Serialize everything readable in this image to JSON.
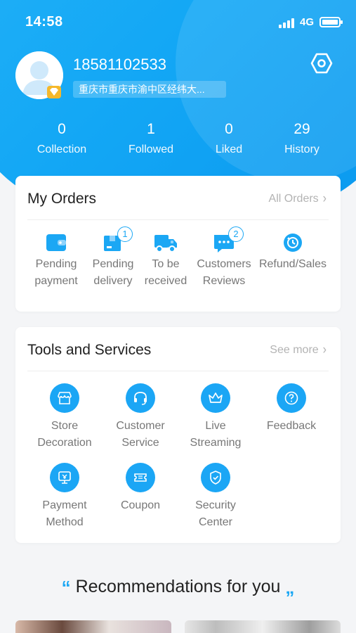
{
  "status_bar": {
    "time": "14:58",
    "network": "4G",
    "battery_level": 1.0
  },
  "profile": {
    "phone": "18581102533",
    "address": "重庆市重庆市渝中区经纬大..."
  },
  "stats": [
    {
      "value": "0",
      "label": "Collection"
    },
    {
      "value": "1",
      "label": "Followed"
    },
    {
      "value": "0",
      "label": "Liked"
    },
    {
      "value": "29",
      "label": "History"
    }
  ],
  "orders": {
    "title": "My Orders",
    "more": "All Orders",
    "items": [
      {
        "line1": "Pending",
        "line2": "payment",
        "icon": "wallet-icon",
        "badge": null
      },
      {
        "line1": "Pending",
        "line2": "delivery",
        "icon": "package-icon",
        "badge": "1"
      },
      {
        "line1": "To be",
        "line2": "received",
        "icon": "truck-icon",
        "badge": null
      },
      {
        "line1": "Customers",
        "line2": "Reviews",
        "icon": "review-icon",
        "badge": "2"
      },
      {
        "line1": "Refund/Sales",
        "line2": "",
        "icon": "refund-icon",
        "badge": null
      }
    ]
  },
  "tools": {
    "title": "Tools and Services",
    "more": "See more",
    "items": [
      {
        "line1": "Store",
        "line2": "Decoration",
        "icon": "store-icon"
      },
      {
        "line1": "Customer",
        "line2": "Service",
        "icon": "headset-icon"
      },
      {
        "line1": "Live",
        "line2": "Streaming",
        "icon": "crown-icon"
      },
      {
        "line1": "Feedback",
        "line2": "",
        "icon": "question-icon"
      },
      {
        "line1": "Payment",
        "line2": "Method",
        "icon": "payment-icon"
      },
      {
        "line1": "Coupon",
        "line2": "",
        "icon": "coupon-icon"
      },
      {
        "line1": "Security",
        "line2": "Center",
        "icon": "shield-icon"
      }
    ]
  },
  "recommendations": {
    "title": "Recommendations for you",
    "open_quote": "“",
    "close_quote": "„"
  },
  "colors": {
    "accent": "#1ba7f4",
    "hero_start": "#2db9f7",
    "hero_end": "#0a98ef",
    "background": "#f4f5f7"
  }
}
